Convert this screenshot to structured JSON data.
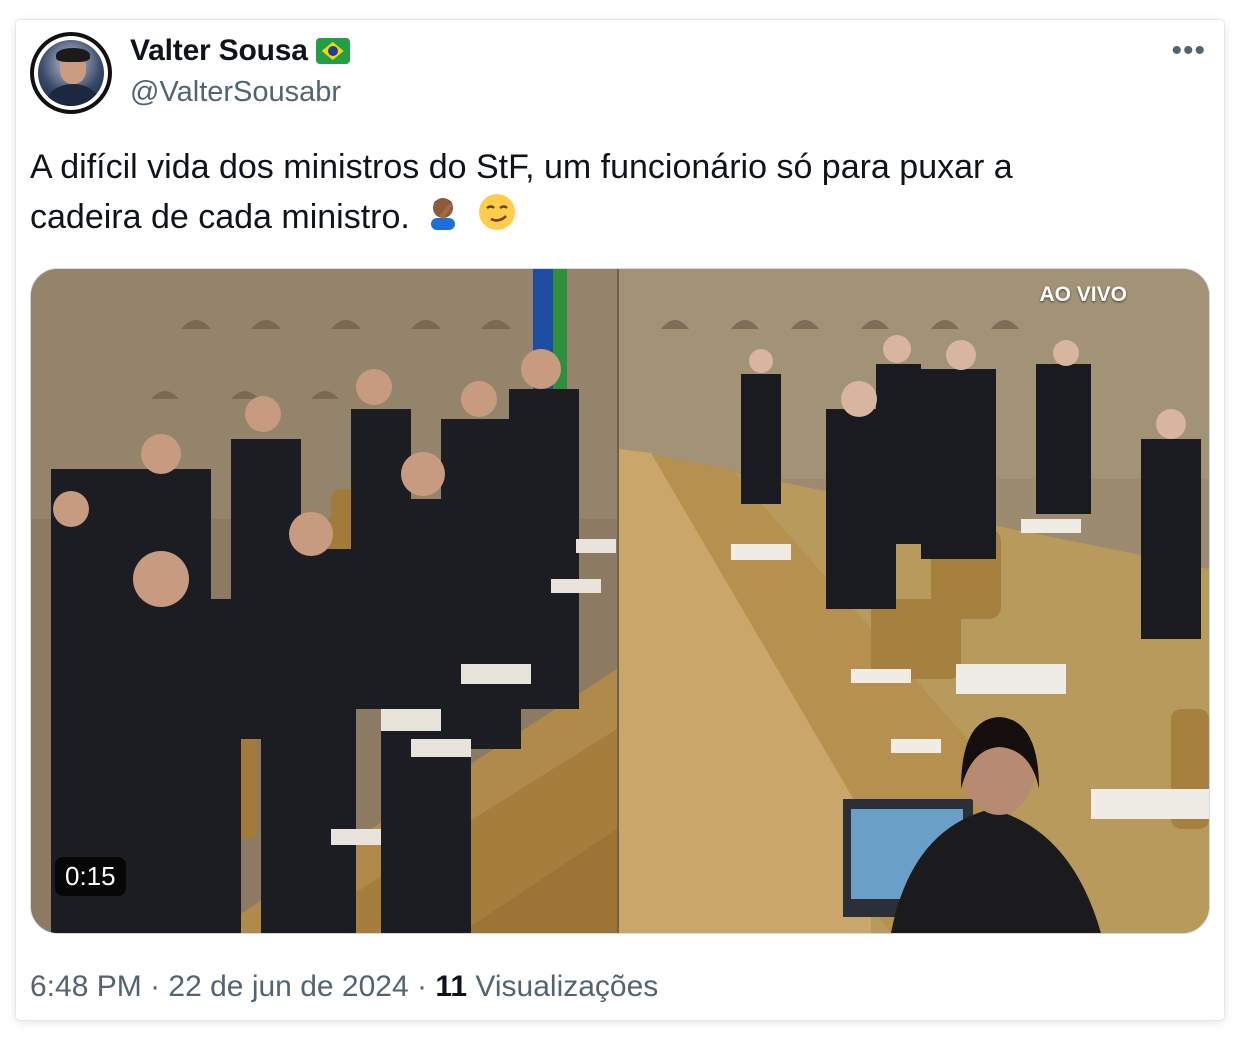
{
  "user": {
    "display_name": "Valter Sousa",
    "handle": "@ValterSousabr",
    "badge": "brazil-flag-emoji"
  },
  "tweet": {
    "text_line1": "A difícil vida dos ministros do StF, um funcionário só para puxar a",
    "text_line2": "cadeira de cada ministro.",
    "emojis": [
      "facepalm-emoji",
      "smirk-emoji"
    ]
  },
  "media": {
    "duration": "0:15",
    "live_label": "AO VIVO"
  },
  "meta": {
    "time": "6:48 PM",
    "separator": "·",
    "date": "22 de jun de 2024",
    "views_count": "11",
    "views_label": "Visualizações"
  },
  "colors": {
    "text": "#0f1419",
    "secondary": "#536471",
    "border": "#cfd9de"
  }
}
